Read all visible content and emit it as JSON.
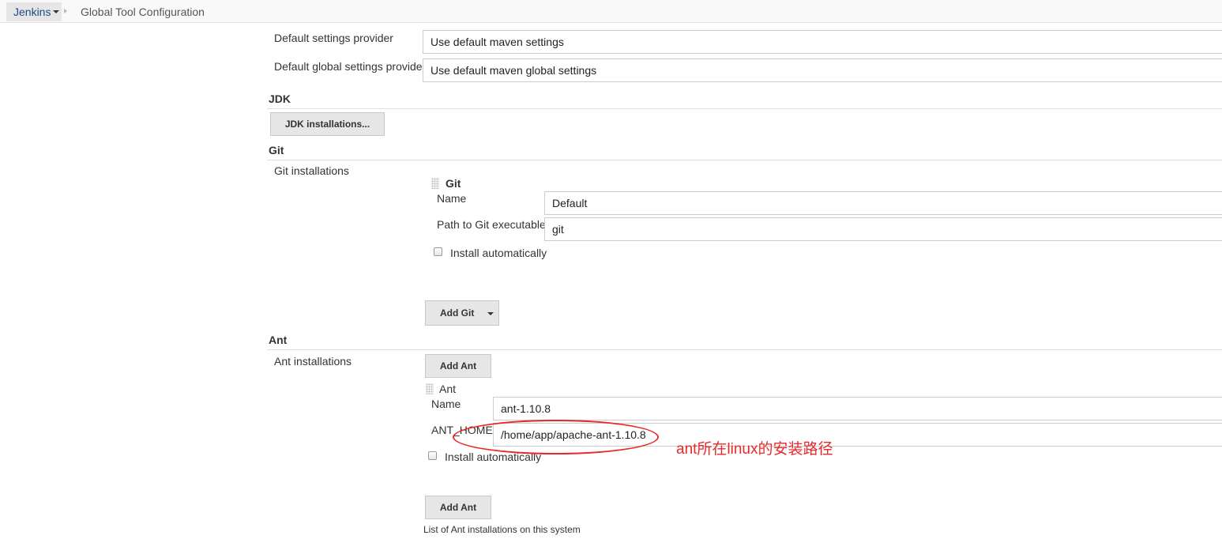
{
  "breadcrumb": {
    "root": "Jenkins",
    "page": "Global Tool Configuration"
  },
  "maven": {
    "settings_label": "Default settings provider",
    "settings_value": "Use default maven settings",
    "global_settings_label": "Default global settings provider",
    "global_settings_value": "Use default maven global settings"
  },
  "jdk": {
    "title": "JDK",
    "button": "JDK installations..."
  },
  "git": {
    "title": "Git",
    "installations_label": "Git installations",
    "item_title": "Git",
    "name_label": "Name",
    "name_value": "Default",
    "path_label": "Path to Git executable",
    "path_value": "git",
    "install_auto": "Install automatically",
    "add_button": "Add Git"
  },
  "ant": {
    "title": "Ant",
    "installations_label": "Ant installations",
    "add_button_top": "Add Ant",
    "item_title": "Ant",
    "name_label": "Name",
    "name_value": "ant-1.10.8",
    "home_label": "ANT_HOME",
    "home_value": "/home/app/apache-ant-1.10.8",
    "install_auto": "Install automatically",
    "add_button_bottom": "Add Ant",
    "help_text": "List of Ant installations on this system"
  },
  "annotation": {
    "text": "ant所在linux的安装路径",
    "color": "#e8282b"
  }
}
